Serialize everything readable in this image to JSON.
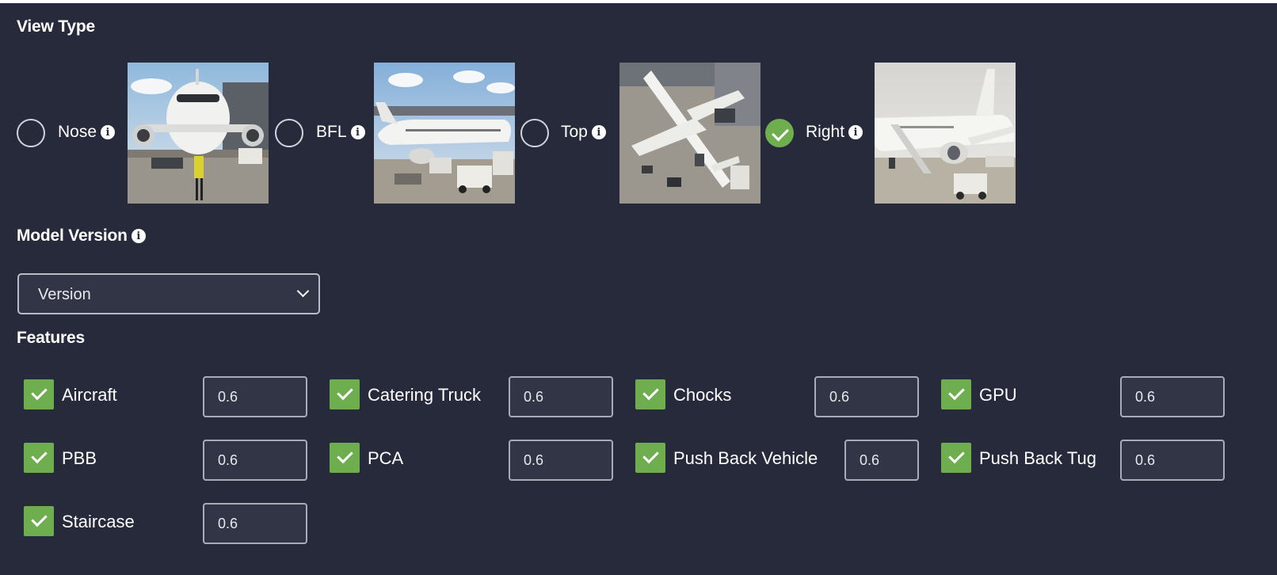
{
  "view_type": {
    "title": "View Type",
    "selected": "Right",
    "options": [
      {
        "label": "Nose",
        "checked": false
      },
      {
        "label": "BFL",
        "checked": false
      },
      {
        "label": "Top",
        "checked": false
      },
      {
        "label": "Right",
        "checked": true
      }
    ]
  },
  "model_version": {
    "title": "Model Version",
    "selected": "Version"
  },
  "features": {
    "title": "Features",
    "items": [
      {
        "label": "Aircraft",
        "checked": true,
        "value": "0.6"
      },
      {
        "label": "Catering Truck",
        "checked": true,
        "value": "0.6"
      },
      {
        "label": "Chocks",
        "checked": true,
        "value": "0.6"
      },
      {
        "label": "GPU",
        "checked": true,
        "value": "0.6"
      },
      {
        "label": "PBB",
        "checked": true,
        "value": "0.6"
      },
      {
        "label": "PCA",
        "checked": true,
        "value": "0.6"
      },
      {
        "label": "Push Back Vehicle",
        "checked": true,
        "value": "0.6"
      },
      {
        "label": "Push Back Tug",
        "checked": true,
        "value": "0.6"
      },
      {
        "label": "Staircase",
        "checked": true,
        "value": "0.6"
      }
    ]
  },
  "colors": {
    "background": "#272a3b",
    "accent": "#6fae4e"
  },
  "icons": [
    "info-icon",
    "chevron-down-icon",
    "check-icon"
  ]
}
